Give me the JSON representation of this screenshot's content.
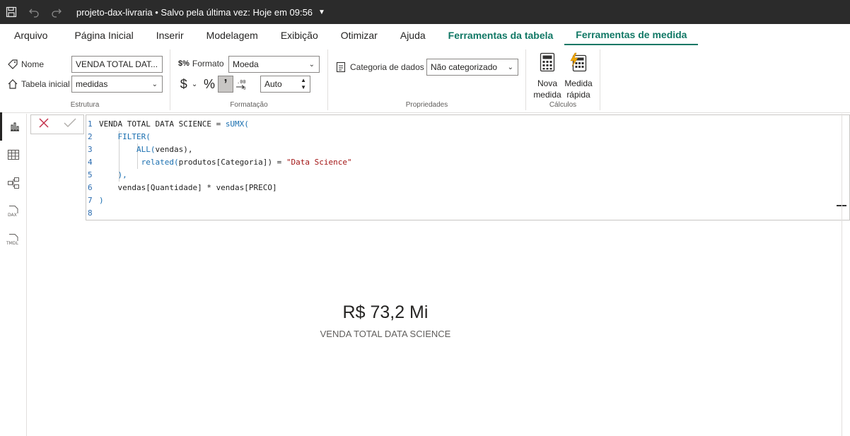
{
  "titlebar": {
    "title": "projeto-dax-livraria • Salvo pela última vez: Hoje em 09:56",
    "icons": [
      "save-icon",
      "undo-icon",
      "redo-icon",
      "caret-down-icon"
    ]
  },
  "tabs": [
    {
      "label": "Arquivo"
    },
    {
      "label": "Página Inicial"
    },
    {
      "label": "Inserir"
    },
    {
      "label": "Modelagem"
    },
    {
      "label": "Exibição"
    },
    {
      "label": "Otimizar"
    },
    {
      "label": "Ajuda"
    },
    {
      "label": "Ferramentas da tabela"
    },
    {
      "label": "Ferramentas de medida"
    }
  ],
  "active_tab": "Ferramentas de medida",
  "accent_color": "#117865",
  "ribbon": {
    "estrutura": {
      "group_label": "Estrutura",
      "nome_label": "Nome",
      "nome_value": "VENDA TOTAL DAT...",
      "tabela_label": "Tabela inicial",
      "tabela_value": "medidas"
    },
    "formatacao": {
      "group_label": "Formatação",
      "formato_label": "Formato",
      "formato_value": "Moeda",
      "currency_symbol": "$",
      "percent_symbol": "%",
      "comma_symbol": "’",
      "decimals_value": "Auto"
    },
    "propriedades": {
      "group_label": "Propriedades",
      "categoria_label": "Categoria de dados",
      "categoria_value": "Não categorizado"
    },
    "calculos": {
      "group_label": "Cálculos",
      "nova_medida_line1": "Nova",
      "nova_medida_line2": "medida",
      "medida_rapida_line1": "Medida",
      "medida_rapida_line2": "rápida"
    }
  },
  "rail": [
    "report-view-icon",
    "table-view-icon",
    "model-view-icon",
    "dax-query-icon",
    "tmdl-view-icon"
  ],
  "editor": {
    "line_numbers": [
      "1",
      "2",
      "3",
      "4",
      "5",
      "6",
      "7",
      "8"
    ],
    "lines": [
      {
        "parts": [
          {
            "t": "VENDA TOTAL DATA SCIENCE = ",
            "c": "code"
          },
          {
            "t": "sUMX(",
            "c": "fn"
          }
        ]
      },
      {
        "parts": [
          {
            "t": "    FILTER(",
            "c": "fn"
          }
        ]
      },
      {
        "parts": [
          {
            "t": "        ",
            "c": "code"
          },
          {
            "t": "ALL(",
            "c": "fn"
          },
          {
            "t": "vendas",
            "c": "code"
          },
          {
            "t": "),",
            "c": "code"
          }
        ]
      },
      {
        "parts": [
          {
            "t": "         ",
            "c": "code"
          },
          {
            "t": "related(",
            "c": "fn"
          },
          {
            "t": "produtos[Categoria]",
            "c": "code"
          },
          {
            "t": ") = ",
            "c": "code"
          },
          {
            "t": "\"Data Science\"",
            "c": "str"
          }
        ]
      },
      {
        "parts": [
          {
            "t": "    ",
            "c": "code"
          },
          {
            "t": "),",
            "c": "fn"
          }
        ]
      },
      {
        "parts": [
          {
            "t": "    vendas[Quantidade] * vendas[PRECO]",
            "c": "code"
          }
        ]
      },
      {
        "parts": [
          {
            "t": ")",
            "c": "fn"
          }
        ]
      },
      {
        "parts": [
          {
            "t": "",
            "c": "code"
          }
        ]
      }
    ]
  },
  "card": {
    "value": "R$ 73,2 Mi",
    "label": "VENDA TOTAL DATA SCIENCE"
  }
}
